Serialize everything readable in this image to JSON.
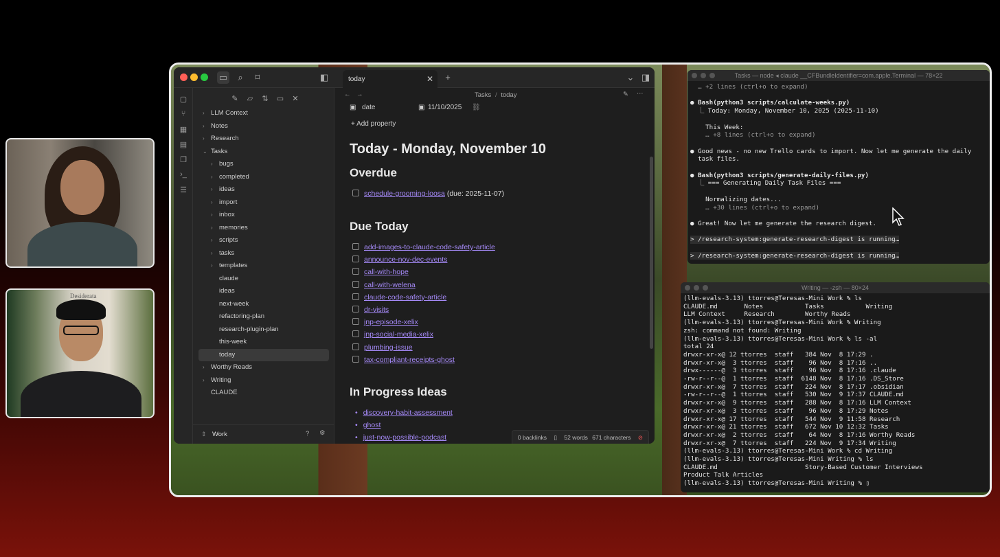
{
  "obsidian": {
    "tab_title": "today",
    "breadcrumb": {
      "folder": "Tasks",
      "sep": "/",
      "note": "today"
    },
    "properties": {
      "date_label": "date",
      "date_value": "11/10/2025",
      "add_property": "Add property"
    },
    "vault_name": "Work",
    "tree": [
      {
        "label": "LLM Context",
        "level": 0,
        "caret": "›"
      },
      {
        "label": "Notes",
        "level": 0,
        "caret": "›"
      },
      {
        "label": "Research",
        "level": 0,
        "caret": "›"
      },
      {
        "label": "Tasks",
        "level": 0,
        "caret": "⌄"
      },
      {
        "label": "bugs",
        "level": 1,
        "caret": "›"
      },
      {
        "label": "completed",
        "level": 1,
        "caret": "›"
      },
      {
        "label": "ideas",
        "level": 1,
        "caret": "›"
      },
      {
        "label": "import",
        "level": 1,
        "caret": "›"
      },
      {
        "label": "inbox",
        "level": 1,
        "caret": "›"
      },
      {
        "label": "memories",
        "level": 1,
        "caret": "›"
      },
      {
        "label": "scripts",
        "level": 1,
        "caret": "›"
      },
      {
        "label": "tasks",
        "level": 1,
        "caret": "›"
      },
      {
        "label": "templates",
        "level": 1,
        "caret": "›"
      },
      {
        "label": "claude",
        "level": 1,
        "caret": ""
      },
      {
        "label": "ideas",
        "level": 1,
        "caret": ""
      },
      {
        "label": "next-week",
        "level": 1,
        "caret": ""
      },
      {
        "label": "refactoring-plan",
        "level": 1,
        "caret": ""
      },
      {
        "label": "research-plugin-plan",
        "level": 1,
        "caret": ""
      },
      {
        "label": "this-week",
        "level": 1,
        "caret": ""
      },
      {
        "label": "today",
        "level": 1,
        "caret": "",
        "selected": true
      },
      {
        "label": "Worthy Reads",
        "level": 0,
        "caret": "›"
      },
      {
        "label": "Writing",
        "level": 0,
        "caret": "›"
      },
      {
        "label": "CLAUDE",
        "level": 0,
        "caret": ""
      }
    ],
    "note": {
      "title": "Today - Monday, November 10",
      "overdue_heading": "Overdue",
      "overdue": [
        {
          "link": "schedule-grooming-loosa",
          "suffix": " (due: 2025-11-07)"
        }
      ],
      "due_heading": "Due Today",
      "due": [
        "add-images-to-claude-code-safety-article",
        "announce-nov-dec-events",
        "call-with-hope",
        "call-with-welena",
        "claude-code-safety-article",
        "dr-visits",
        "jnp-episode-xelix",
        "jnp-social-media-xelix",
        "plumbing-issue",
        "tax-compliant-receipts-ghost"
      ],
      "ideas_heading": "In Progress Ideas",
      "ideas": [
        "discovery-habit-assessment",
        "ghost",
        "just-now-possible-podcast"
      ]
    },
    "status": {
      "backlinks": "0 backlinks",
      "words": "52 words",
      "chars": "671 characters"
    }
  },
  "terminal1": {
    "title": "Tasks — node ◂ claude __CFBundleIdentifier=com.apple.Terminal — 78×22",
    "lines": [
      {
        "t": "  … +2 lines (ctrl+o to expand)",
        "c": "dim"
      },
      {
        "t": "",
        "c": ""
      },
      {
        "t": "● Bash(python3 scripts/calculate-weeks.py)",
        "c": "bold"
      },
      {
        "t": "  ⎿ Today: Monday, November 10, 2025 (2025-11-10)",
        "c": ""
      },
      {
        "t": "",
        "c": ""
      },
      {
        "t": "    This Week:",
        "c": ""
      },
      {
        "t": "    … +8 lines (ctrl+o to expand)",
        "c": "dim"
      },
      {
        "t": "",
        "c": ""
      },
      {
        "t": "● Good news - no new Trello cards to import. Now let me generate the daily",
        "c": ""
      },
      {
        "t": "  task files.",
        "c": ""
      },
      {
        "t": "",
        "c": ""
      },
      {
        "t": "● Bash(python3 scripts/generate-daily-files.py)",
        "c": "bold"
      },
      {
        "t": "  ⎿ === Generating Daily Task Files ===",
        "c": ""
      },
      {
        "t": "",
        "c": ""
      },
      {
        "t": "    Normalizing dates...",
        "c": ""
      },
      {
        "t": "    … +30 lines (ctrl+o to expand)",
        "c": "dim"
      },
      {
        "t": "",
        "c": ""
      },
      {
        "t": "● Great! Now let me generate the research digest.",
        "c": ""
      },
      {
        "t": "",
        "c": ""
      },
      {
        "t": "> /research-system:generate-research-digest is running…",
        "c": "box"
      },
      {
        "t": "",
        "c": ""
      },
      {
        "t": "> /research-system:generate-research-digest is running…",
        "c": "box"
      }
    ]
  },
  "terminal2": {
    "title": "Writing — -zsh — 80×24",
    "lines": [
      "(llm-evals-3.13) ttorres@Teresas-Mini Work % ls",
      "CLAUDE.md       Notes           Tasks           Writing",
      "LLM Context     Research        Worthy Reads",
      "(llm-evals-3.13) ttorres@Teresas-Mini Work % Writing",
      "zsh: command not found: Writing",
      "(llm-evals-3.13) ttorres@Teresas-Mini Work % ls -al",
      "total 24",
      "drwxr-xr-x@ 12 ttorres  staff   384 Nov  8 17:29 .",
      "drwxr-xr-x@  3 ttorres  staff    96 Nov  8 17:16 ..",
      "drwx------@  3 ttorres  staff    96 Nov  8 17:16 .claude",
      "-rw-r--r--@  1 ttorres  staff  6148 Nov  8 17:16 .DS_Store",
      "drwxr-xr-x@  7 ttorres  staff   224 Nov  8 17:17 .obsidian",
      "-rw-r--r--@  1 ttorres  staff   530 Nov  9 17:37 CLAUDE.md",
      "drwxr-xr-x@  9 ttorres  staff   288 Nov  8 17:16 LLM Context",
      "drwxr-xr-x@  3 ttorres  staff    96 Nov  8 17:29 Notes",
      "drwxr-xr-x@ 17 ttorres  staff   544 Nov  9 11:58 Research",
      "drwxr-xr-x@ 21 ttorres  staff   672 Nov 10 12:32 Tasks",
      "drwxr-xr-x@  2 ttorres  staff    64 Nov  8 17:16 Worthy Reads",
      "drwxr-xr-x@  7 ttorres  staff   224 Nov  9 17:34 Writing",
      "(llm-evals-3.13) ttorres@Teresas-Mini Work % cd Writing",
      "(llm-evals-3.13) ttorres@Teresas-Mini Writing % ls",
      "CLAUDE.md                       Story-Based Customer Interviews",
      "Product Talk Articles",
      "(llm-evals-3.13) ttorres@Teresas-Mini Writing % ▯"
    ]
  },
  "webcam2_sign": "Desiderata",
  "colors": {
    "accent": "#a68af9",
    "editor_bg": "#1e1e1e",
    "sidebar_bg": "#262626"
  }
}
